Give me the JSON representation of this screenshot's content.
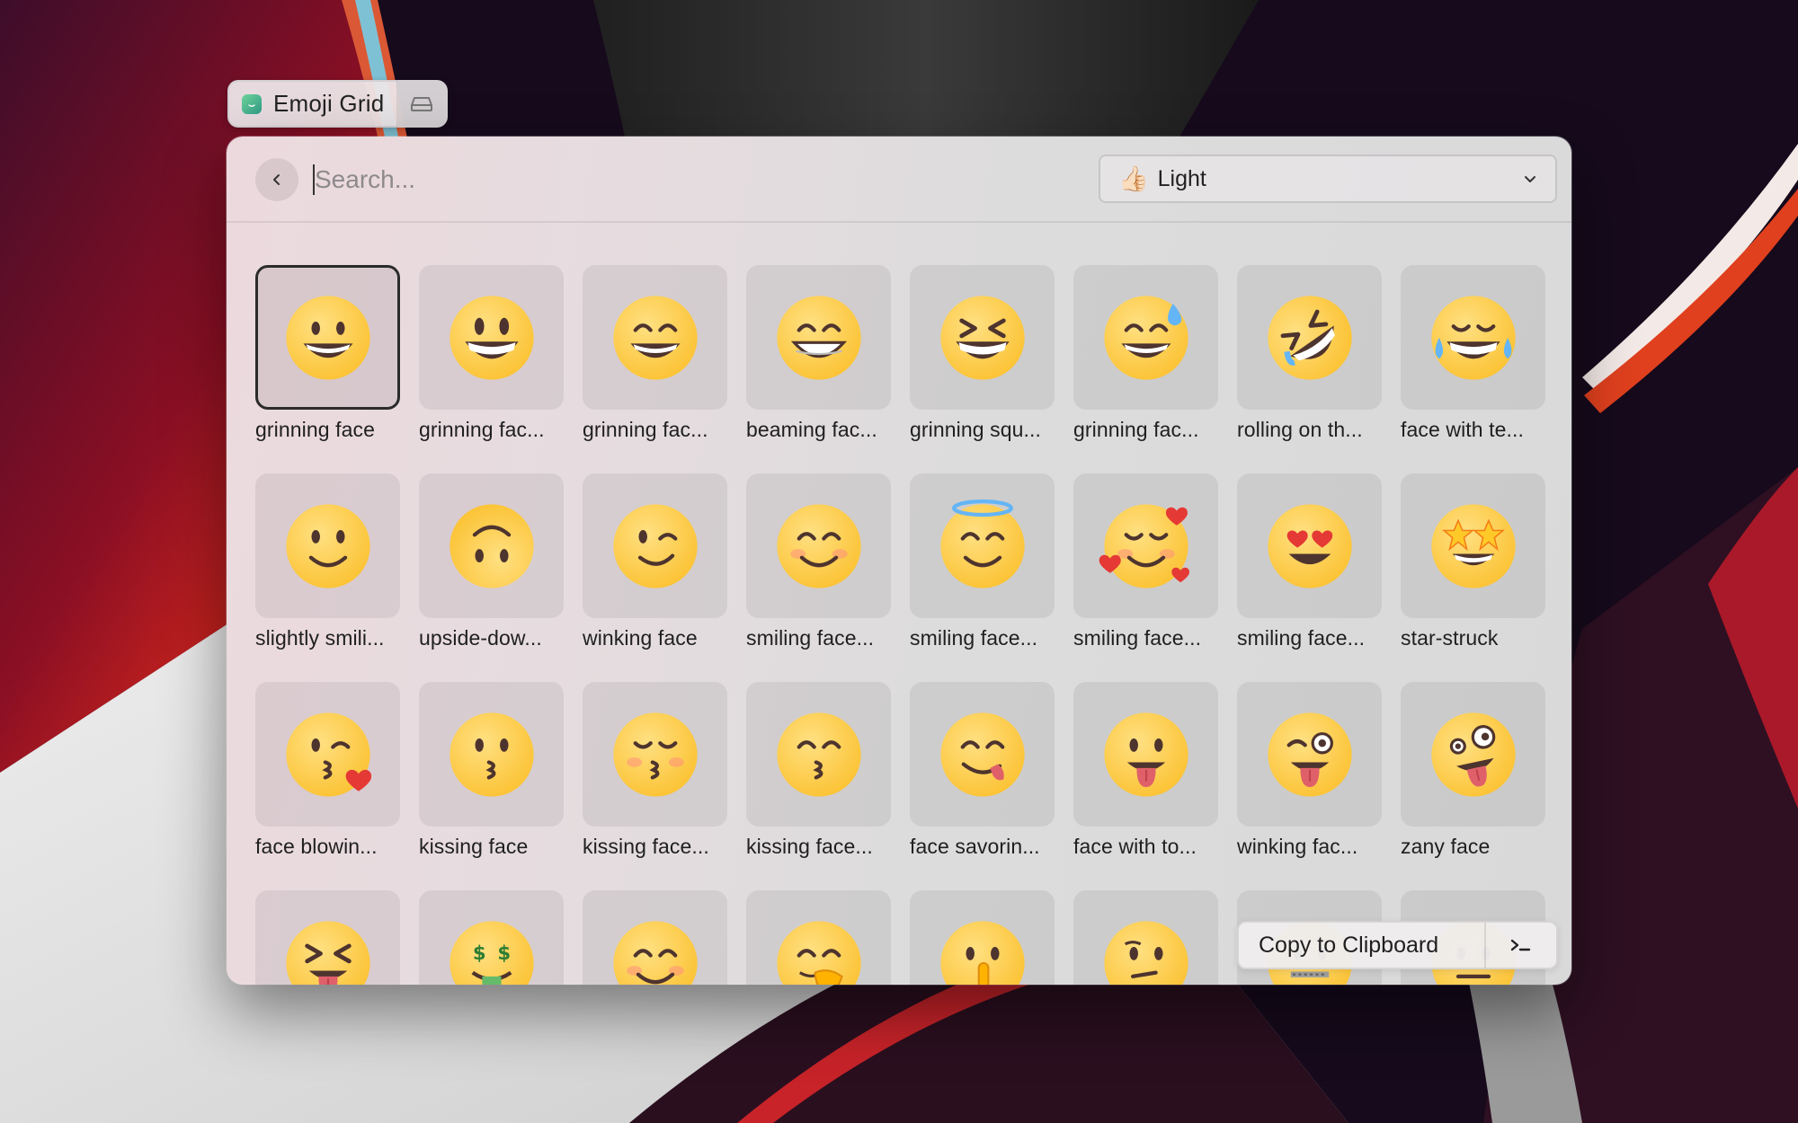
{
  "app": {
    "title": "Emoji Grid",
    "storage_icon": "tray-icon"
  },
  "search": {
    "placeholder": "Search...",
    "value": ""
  },
  "skin_tone": {
    "emoji": "👍🏻",
    "selected": "Light"
  },
  "actions": {
    "primary_label": "Copy to Clipboard",
    "secondary_icon": "terminal-icon"
  },
  "colors": {
    "emoji_yellow": "#fbc02d",
    "selection_border": "#2b2b2b"
  },
  "emojis": [
    {
      "label": "grinning face",
      "icon": "grinning-face",
      "selected": true
    },
    {
      "label": "grinning fac...",
      "icon": "grinning-face-big-eyes"
    },
    {
      "label": "grinning fac...",
      "icon": "grinning-face-smiling-eyes"
    },
    {
      "label": "beaming fac...",
      "icon": "beaming-face"
    },
    {
      "label": "grinning squ...",
      "icon": "grinning-squinting-face"
    },
    {
      "label": "grinning fac...",
      "icon": "grinning-face-sweat"
    },
    {
      "label": "rolling on th...",
      "icon": "rolling-on-floor-laughing"
    },
    {
      "label": "face with te...",
      "icon": "face-with-tears-of-joy"
    },
    {
      "label": "slightly smili...",
      "icon": "slightly-smiling-face"
    },
    {
      "label": "upside-dow...",
      "icon": "upside-down-face"
    },
    {
      "label": "winking face",
      "icon": "winking-face"
    },
    {
      "label": "smiling face...",
      "icon": "smiling-face-smiling-eyes"
    },
    {
      "label": "smiling face...",
      "icon": "smiling-face-halo"
    },
    {
      "label": "smiling face...",
      "icon": "smiling-face-hearts"
    },
    {
      "label": "smiling face...",
      "icon": "smiling-face-heart-eyes"
    },
    {
      "label": "star-struck",
      "icon": "star-struck"
    },
    {
      "label": "face blowin...",
      "icon": "face-blowing-kiss"
    },
    {
      "label": "kissing face",
      "icon": "kissing-face"
    },
    {
      "label": "kissing face...",
      "icon": "kissing-face-closed-eyes"
    },
    {
      "label": "kissing face...",
      "icon": "kissing-face-smiling-eyes"
    },
    {
      "label": "face savorin...",
      "icon": "face-savoring-food"
    },
    {
      "label": "face with to...",
      "icon": "face-with-tongue"
    },
    {
      "label": "winking fac...",
      "icon": "winking-face-tongue"
    },
    {
      "label": "zany face",
      "icon": "zany-face"
    },
    {
      "label": "",
      "icon": "squinting-face-tongue"
    },
    {
      "label": "",
      "icon": "money-mouth-face"
    },
    {
      "label": "",
      "icon": "smiling-face-open-hands"
    },
    {
      "label": "",
      "icon": "face-hand-over-mouth"
    },
    {
      "label": "",
      "icon": "shushing-face"
    },
    {
      "label": "",
      "icon": "thinking-face"
    },
    {
      "label": "",
      "icon": "zipper-mouth-face"
    },
    {
      "label": "",
      "icon": "neutral-face"
    }
  ]
}
